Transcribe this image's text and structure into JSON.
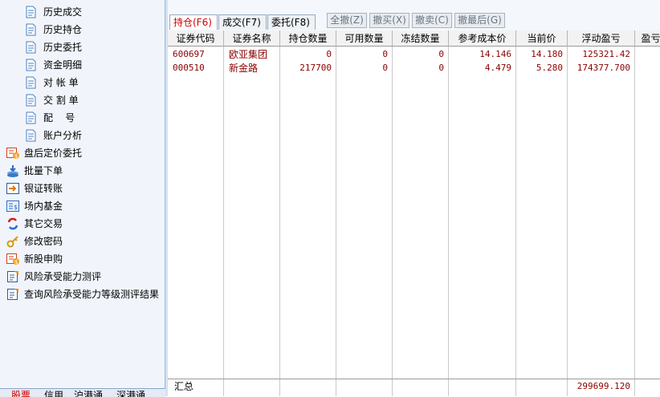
{
  "sidebar": {
    "sub_items": [
      {
        "label": "历史成交",
        "icon": "document-icon"
      },
      {
        "label": "历史持仓",
        "icon": "document-icon"
      },
      {
        "label": "历史委托",
        "icon": "document-icon"
      },
      {
        "label": "资金明细",
        "icon": "document-icon"
      },
      {
        "label": "对 帐 单",
        "icon": "document-icon"
      },
      {
        "label": "交 割 单",
        "icon": "document-icon"
      },
      {
        "label": "配    号",
        "icon": "document-icon"
      },
      {
        "label": "账户分析",
        "icon": "document-icon"
      }
    ],
    "items": [
      {
        "label": "盘后定价委托",
        "icon": "after-hours-order-icon"
      },
      {
        "label": "批量下单",
        "icon": "batch-order-icon"
      },
      {
        "label": "银证转账",
        "icon": "bank-transfer-icon"
      },
      {
        "label": "场内基金",
        "icon": "fund-icon"
      },
      {
        "label": "其它交易",
        "icon": "other-trade-icon"
      },
      {
        "label": "修改密码",
        "icon": "key-icon"
      },
      {
        "label": "新股申购",
        "icon": "ipo-icon"
      },
      {
        "label": "风险承受能力测评",
        "icon": "risk-assessment-icon"
      },
      {
        "label": "查询风险承受能力等级测评结果",
        "icon": "risk-result-icon"
      }
    ],
    "bottom_tabs": [
      "股票",
      "信用",
      "沪港通",
      "深港通"
    ]
  },
  "tabs": [
    {
      "label": "持仓(F6)",
      "active": true
    },
    {
      "label": "成交(F7)",
      "active": false
    },
    {
      "label": "委托(F8)",
      "active": false
    }
  ],
  "actions": [
    "全撤(Z)",
    "撤买(X)",
    "撤卖(C)",
    "撤最后(G)"
  ],
  "table": {
    "headers": [
      "证券代码",
      "证券名称",
      "持仓数量",
      "可用数量",
      "冻结数量",
      "参考成本价",
      "当前价",
      "浮动盈亏",
      "盈亏"
    ],
    "rows": [
      [
        "600697",
        "欧亚集团",
        "0",
        "0",
        "0",
        "14.146",
        "14.180",
        "125321.42"
      ],
      [
        "000510",
        "新金路",
        "217700",
        "0",
        "0",
        "4.479",
        "5.280",
        "174377.700"
      ]
    ],
    "summary_label": "汇总",
    "summary_value": "299699.120"
  },
  "colors": {
    "accent": "#d40000",
    "data_text": "#8b0000",
    "sidebar_bg": "#f1f5fb"
  }
}
